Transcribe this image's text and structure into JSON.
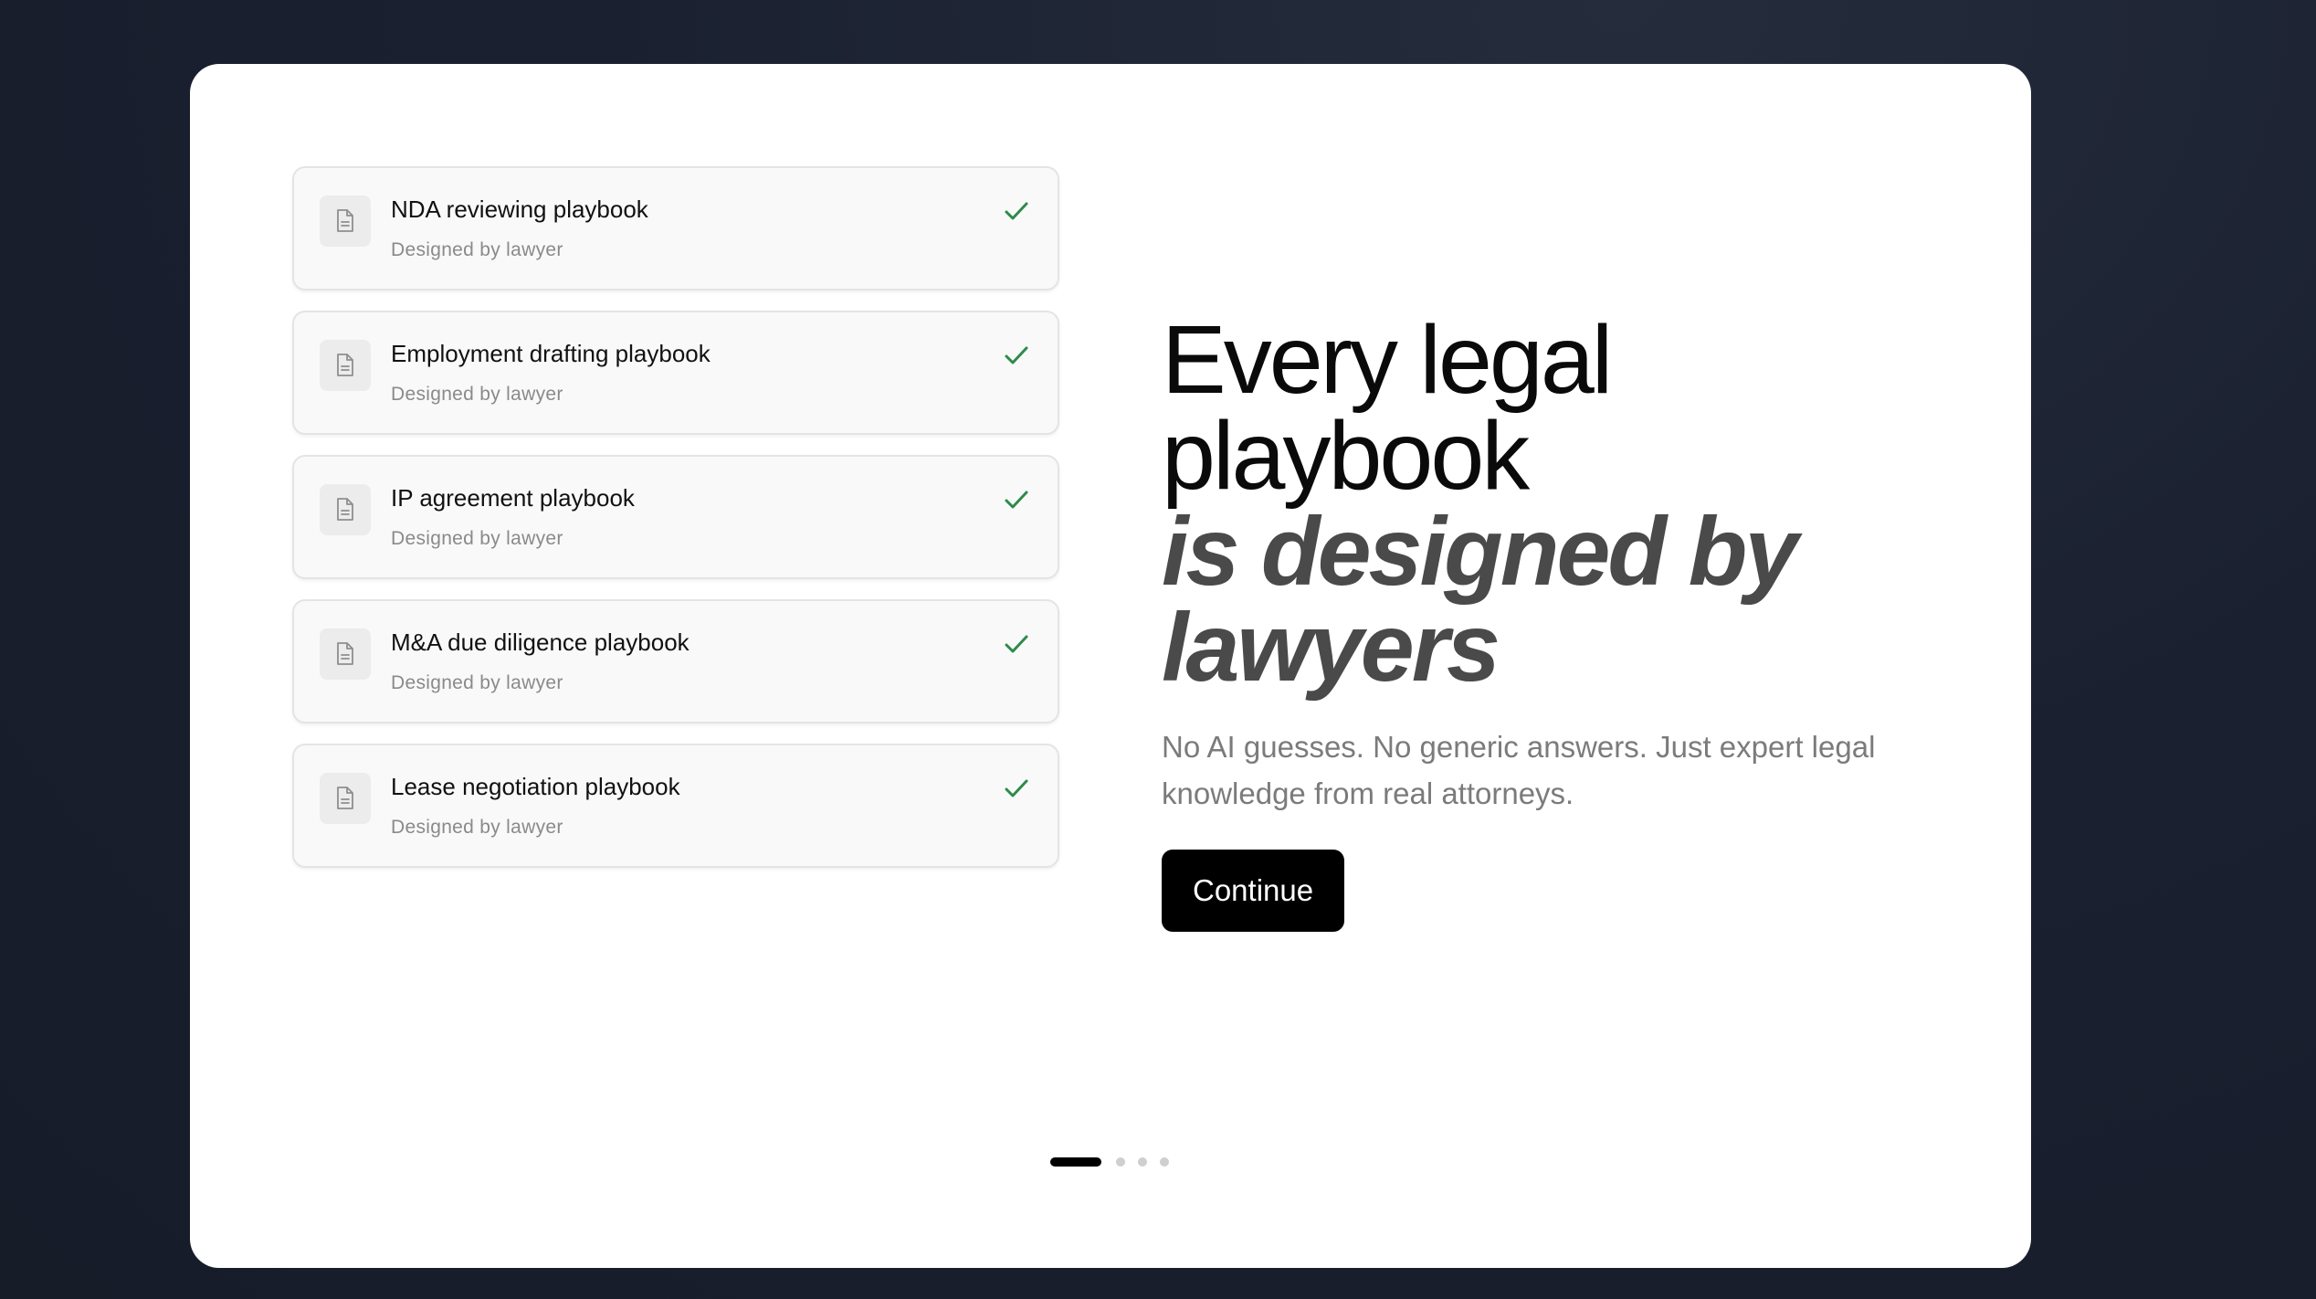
{
  "playbooks": [
    {
      "title": "NDA reviewing playbook",
      "subtitle": "Designed by lawyer",
      "icon": "document-icon",
      "status_icon": "check-icon"
    },
    {
      "title": "Employment drafting playbook",
      "subtitle": "Designed by lawyer",
      "icon": "document-icon",
      "status_icon": "check-icon"
    },
    {
      "title": "IP agreement playbook",
      "subtitle": "Designed by lawyer",
      "icon": "document-icon",
      "status_icon": "check-icon"
    },
    {
      "title": "M&A due diligence playbook",
      "subtitle": "Designed by lawyer",
      "icon": "document-icon",
      "status_icon": "check-icon"
    },
    {
      "title": "Lease negotiation playbook",
      "subtitle": "Designed by lawyer",
      "icon": "document-icon",
      "status_icon": "check-icon"
    }
  ],
  "hero": {
    "line1": "Every legal",
    "line2": "playbook",
    "line3": "is designed by lawyers",
    "subtext": "No AI guesses. No generic answers. Just expert legal knowledge from real attorneys.",
    "cta_label": "Continue"
  },
  "pagination": {
    "current": 1,
    "total": 4
  },
  "colors": {
    "check": "#2e8b4a",
    "cta_bg": "#000000",
    "muted_text": "#7b7b7b"
  }
}
